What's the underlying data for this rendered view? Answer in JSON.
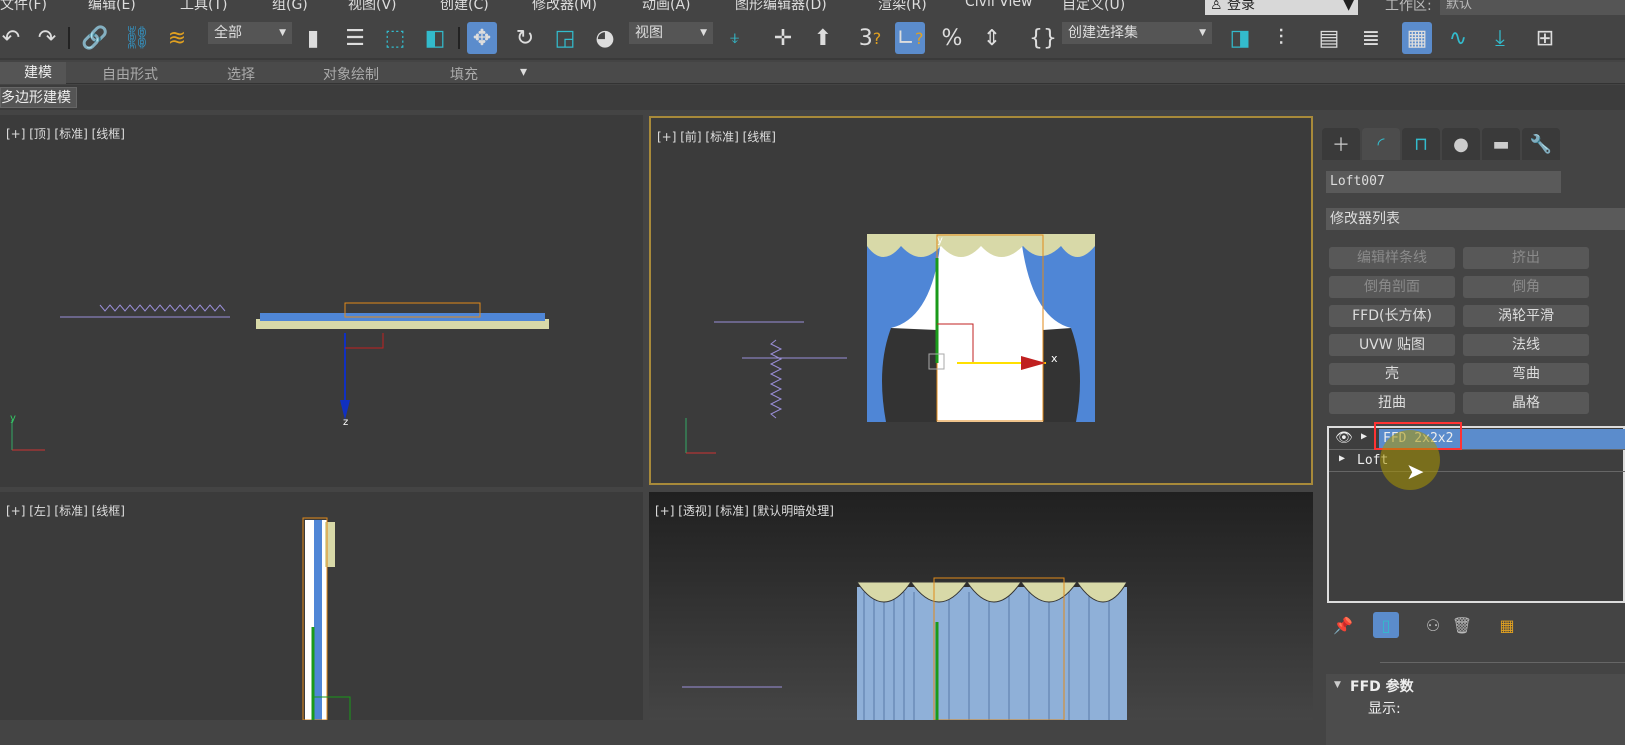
{
  "menu": [
    "文件(F)",
    "编辑(E)",
    "工具(T)",
    "组(G)",
    "视图(V)",
    "创建(C)",
    "修改器(M)",
    "动画(A)",
    "图形编辑器(D)",
    "渲染(R)",
    "Civil View",
    "自定义(U)"
  ],
  "login": "登录",
  "workspace": {
    "label": "工作区:",
    "value": "默认"
  },
  "toolbar": {
    "selection_filter": "全部",
    "ref_coord": "视图",
    "named_selection": "创建选择集",
    "snap_toggle": "3"
  },
  "ribbon": {
    "tabs": [
      "建模",
      "自由形式",
      "选择",
      "对象绘制",
      "填充"
    ],
    "active": "建模",
    "sub": "多边形建模"
  },
  "viewports": {
    "top": "[+] [顶] [标准] [线框]",
    "front": "[+] [前] [标准] [线框]",
    "left": "[+] [左] [标准] [线框]",
    "persp": "[+] [透视] [标准] [默认明暗处理]"
  },
  "axis": {
    "x": "x",
    "y": "y",
    "z": "z"
  },
  "panel": {
    "object_name": "Loft007",
    "modifier_list": "修改器列表",
    "buttons": [
      {
        "label": "编辑样条线",
        "enabled": false
      },
      {
        "label": "挤出",
        "enabled": false
      },
      {
        "label": "倒角剖面",
        "enabled": false
      },
      {
        "label": "倒角",
        "enabled": false
      },
      {
        "label": "FFD(长方体)",
        "enabled": true
      },
      {
        "label": "涡轮平滑",
        "enabled": true
      },
      {
        "label": "UVW 贴图",
        "enabled": true
      },
      {
        "label": "法线",
        "enabled": true
      },
      {
        "label": "壳",
        "enabled": true
      },
      {
        "label": "弯曲",
        "enabled": true
      },
      {
        "label": "扭曲",
        "enabled": true
      },
      {
        "label": "晶格",
        "enabled": true
      }
    ],
    "stack": [
      "FFD 2x2x2",
      "Loft"
    ],
    "rollout_title": "FFD 参数",
    "display_label": "显示:"
  },
  "colors": {
    "accent": "#5b8ccc",
    "highlight": "#ff3333",
    "viewport_border": "#a88a3a",
    "curtain_blue": "#4f86d6",
    "valance": "#d8d9a8"
  }
}
